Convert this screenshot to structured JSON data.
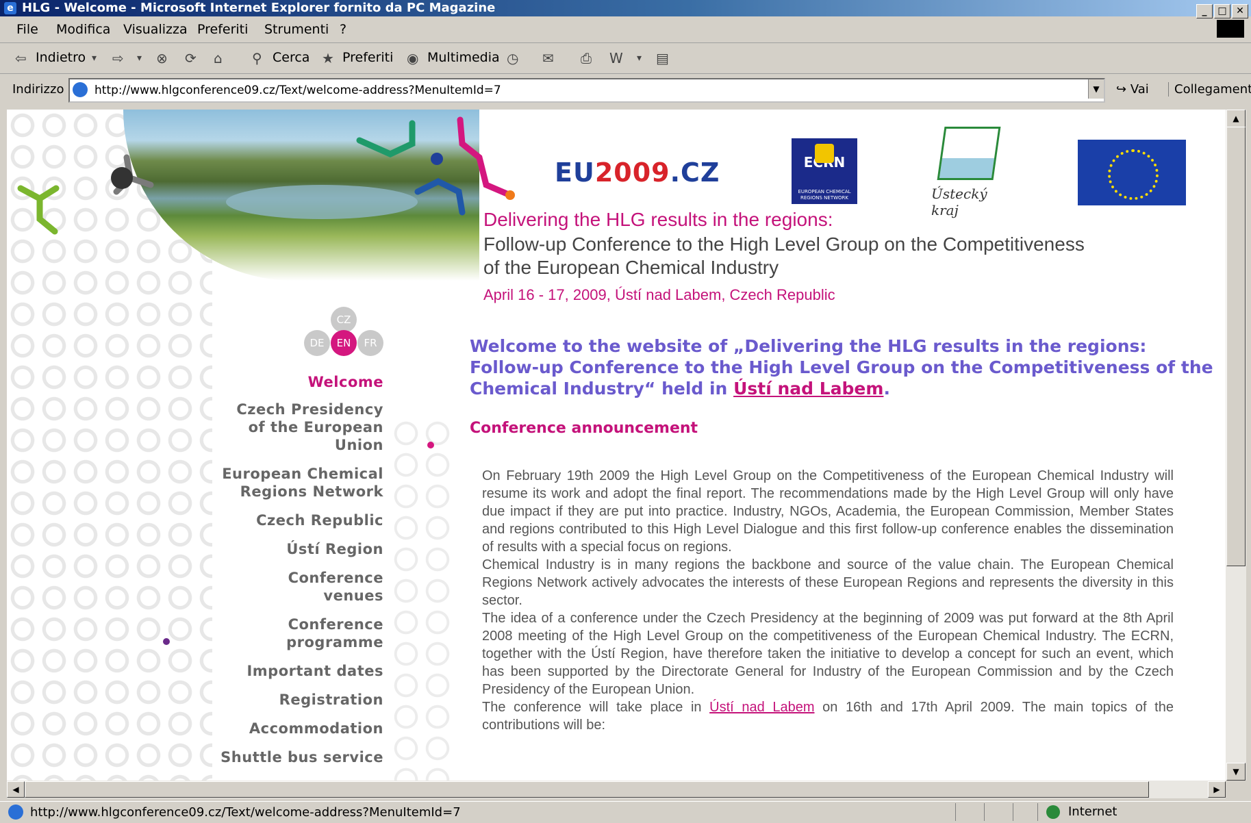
{
  "window": {
    "title": "HLG - Welcome - Microsoft Internet Explorer fornito da PC Magazine",
    "controls": [
      "_",
      "□",
      "✕"
    ]
  },
  "menu": [
    "File",
    "Modifica",
    "Visualizza",
    "Preferiti",
    "Strumenti",
    "?"
  ],
  "toolbar": {
    "back": "Indietro",
    "search": "Cerca",
    "favorites": "Preferiti",
    "media": "Multimedia"
  },
  "address": {
    "label": "Indirizzo",
    "url": "http://www.hlgconference09.cz/Text/welcome-address?MenuItemId=7",
    "go": "Vai",
    "links": "Collegamenti"
  },
  "status": {
    "text": "http://www.hlgconference09.cz/Text/welcome-address?MenuItemId=7",
    "zone": "Internet"
  },
  "logos": {
    "eu2009_prefix": "EU",
    "eu2009_num": "2009",
    "eu2009_suffix": ".CZ",
    "ecrn": "ECRN",
    "ecrn_sub": "EUROPEAN CHEMICAL REGIONS NETWORK",
    "usti": "Ústecký kraj"
  },
  "header": {
    "line1": "Delivering the HLG results in the regions:",
    "line2": "Follow-up Conference to the High Level Group on the Competitiveness",
    "line3": "of the European Chemical Industry",
    "date": "April 16 - 17, 2009, Ústí nad Labem, Czech Republic"
  },
  "languages": [
    "CZ",
    "DE",
    "EN",
    "FR"
  ],
  "nav": {
    "welcome": "Welcome",
    "presidency_1": "Czech Presidency",
    "presidency_2": "of the European",
    "presidency_3": "Union",
    "ecrn_1": "European Chemical",
    "ecrn_2": "Regions Network",
    "czech": "Czech Republic",
    "usti": "Ústí Region",
    "venues_1": "Conference",
    "venues_2": "venues",
    "programme_1": "Conference",
    "programme_2": "programme",
    "dates": "Important dates",
    "registration": "Registration",
    "accommodation": "Accommodation",
    "shuttle": "Shuttle bus service"
  },
  "content": {
    "welcome_text": "Welcome to the website of „Delivering the HLG results in the regions: Follow-up Conference to the High Level Group on the Competitiveness of the Chemical Industry“ held in ",
    "welcome_link": "Ústí nad Labem",
    "welcome_end": ".",
    "announcement": "Conference announcement",
    "p1": "On February 19th 2009 the High Level Group on the Competitiveness of the European Chemical Industry will resume its work and adopt the final report. The recommendations made by the High Level Group will only have due impact if they are put into practice. Industry, NGOs, Academia, the European Commission, Member States and regions contributed to this High Level Dialogue and this first follow-up conference enables the dissemination of results with a special focus on regions.",
    "p2": "Chemical Industry is in many regions the backbone and source of the value chain. The European Chemical Regions Network actively advocates the interests of these European Regions and represents the diversity in this sector.",
    "p3": "The idea of a conference under the Czech Presidency at the beginning of 2009 was put forward at the 8th April 2008 meeting of the High Level Group on the competitiveness of the European Chemical Industry. The ECRN, together with the Ústí Region, have therefore taken the initiative to develop a concept for such an event, which has been supported by the Directorate General for Industry of the European Commission and by the Czech Presidency of the European Union.",
    "p4_start": "The conference will take place in ",
    "p4_link": "Ústí nad Labem",
    "p4_end": " on 16th and 17th April 2009. The main topics of the contributions will be:"
  },
  "colors": {
    "accent": "#c4127a",
    "welcome": "#6a5acd",
    "nav": "#666666"
  }
}
